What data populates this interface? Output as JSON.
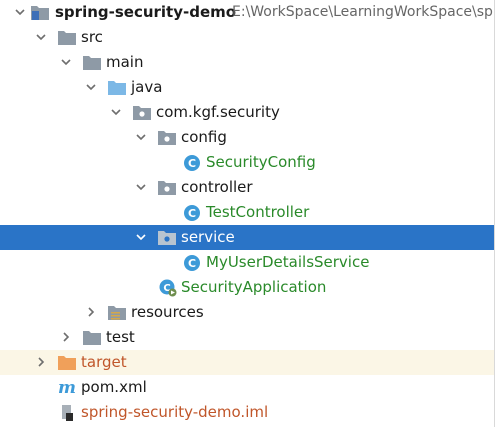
{
  "project": {
    "name": "spring-security-demo",
    "path": "E:\\WorkSpace\\LearningWorkSpace\\sp"
  },
  "tree": {
    "src": "src",
    "main": "main",
    "java": "java",
    "package": "com.kgf.security",
    "config": "config",
    "security_config": "SecurityConfig",
    "controller": "controller",
    "test_controller": "TestController",
    "service": "service",
    "user_details_service": "MyUserDetailsService",
    "security_application": "SecurityApplication",
    "resources": "resources",
    "test": "test",
    "target": "target",
    "pom": "pom.xml",
    "iml": "spring-security-demo.iml"
  },
  "colors": {
    "selection": "#2a74c7",
    "class_text": "#2a8a2a",
    "excluded_text": "#c0562a",
    "folder": "#8e9aa6",
    "source_folder": "#7cb8e6",
    "excluded_folder": "#f0a05a",
    "class_icon": "#3d9ad8"
  }
}
